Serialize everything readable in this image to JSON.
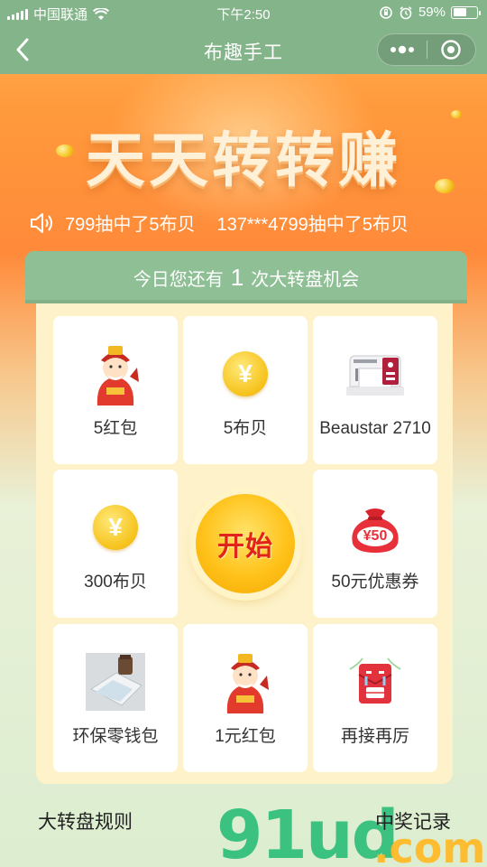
{
  "status_bar": {
    "carrier": "中国联通",
    "time": "下午2:50",
    "battery_percent": "59%",
    "battery_level": 0.59
  },
  "nav": {
    "title": "布趣手工"
  },
  "banner": {
    "headline": "天天转转赚",
    "ticker": [
      "799抽中了5布贝",
      "137***4799抽中了5布贝"
    ]
  },
  "chance": {
    "prefix": "今日您还有",
    "count": "1",
    "suffix": "次大转盘机会"
  },
  "prizes": [
    {
      "label": "5红包",
      "icon": "fortune-god-icon"
    },
    {
      "label": "5布贝",
      "icon": "yuan-coin-icon"
    },
    {
      "label": "Beaustar 2710",
      "icon": "sewing-machine-icon"
    },
    {
      "label": "300布贝",
      "icon": "yuan-coin-icon"
    },
    {
      "label": "50元优惠券",
      "icon": "money-bag-icon"
    },
    {
      "label": "环保零钱包",
      "icon": "coin-purse-icon"
    },
    {
      "label": "1元红包",
      "icon": "fortune-god-icon"
    },
    {
      "label": "再接再厉",
      "icon": "crying-envelope-icon"
    }
  ],
  "coin_symbol": "¥",
  "bag_text": "¥50",
  "start_label": "开始",
  "footer": {
    "rules_label": "大转盘规则",
    "records_label": "中奖记录"
  },
  "watermark": {
    "main": "91ud",
    "sub": ".com"
  },
  "colors": {
    "nav_green": "#84b48a",
    "board_bg": "#fdf2c9",
    "start_text": "#e2231a",
    "coin_gold": "#f6c21b"
  }
}
